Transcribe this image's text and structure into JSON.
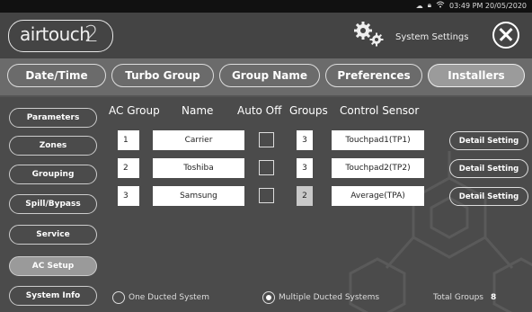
{
  "status_bar": {
    "time_date": "03:49 PM 20/05/2020",
    "icons": [
      "cloud-icon",
      "lock-icon",
      "wifi-icon"
    ]
  },
  "header": {
    "logo_text": "airtouch",
    "logo_suffix": "2",
    "title": "System Settings",
    "settings_icon": "gears-icon",
    "close_icon": "close-icon"
  },
  "tabs": [
    {
      "label": "Date/Time",
      "active": false
    },
    {
      "label": "Turbo Group",
      "active": false
    },
    {
      "label": "Group Name",
      "active": false
    },
    {
      "label": "Preferences",
      "active": false
    },
    {
      "label": "Installers",
      "active": true
    }
  ],
  "sidebar": [
    {
      "label": "Parameters",
      "active": false
    },
    {
      "label": "Zones",
      "active": false
    },
    {
      "label": "Grouping",
      "active": false
    },
    {
      "label": "Spill/Bypass",
      "active": false
    },
    {
      "label": "Service",
      "active": false
    },
    {
      "label": "AC Setup",
      "active": true
    },
    {
      "label": "System Info",
      "active": false
    }
  ],
  "table": {
    "headers": {
      "ac_group": "AC Group",
      "name": "Name",
      "auto_off": "Auto Off",
      "groups": "Groups",
      "control_sensor": "Control Sensor"
    },
    "rows": [
      {
        "ac_group": "1",
        "name": "Carrier",
        "auto_off": false,
        "groups": "3",
        "groups_dim": false,
        "control_sensor": "Touchpad1(TP1)",
        "detail": "Detail Setting"
      },
      {
        "ac_group": "2",
        "name": "Toshiba",
        "auto_off": false,
        "groups": "3",
        "groups_dim": false,
        "control_sensor": "Touchpad2(TP2)",
        "detail": "Detail Setting"
      },
      {
        "ac_group": "3",
        "name": "Samsung",
        "auto_off": false,
        "groups": "2",
        "groups_dim": true,
        "control_sensor": "Average(TPA)",
        "detail": "Detail Setting"
      }
    ]
  },
  "footer": {
    "one_ducted": {
      "label": "One Ducted System",
      "selected": false
    },
    "multiple_ducted": {
      "label": "Multiple Ducted Systems",
      "selected": true
    },
    "total_groups_label": "Total Groups",
    "total_groups_value": "8"
  },
  "colors": {
    "background": "#4b4b4b",
    "tab_bar": "#6b6b6b",
    "active_fill": "#9b9b9b",
    "text": "#ffffff"
  }
}
